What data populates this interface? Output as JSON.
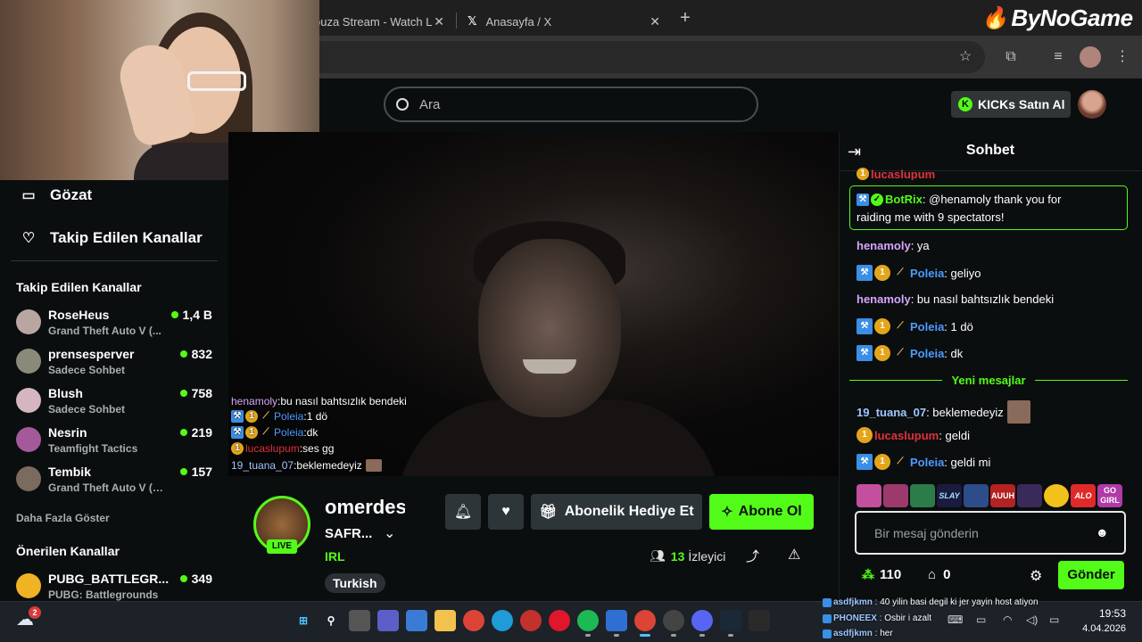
{
  "browser": {
    "tabs": [
      {
        "title": "ouza Stream - Watch L"
      },
      {
        "title": "Anasayfa / X"
      }
    ],
    "new_tab": "+",
    "close": "✕"
  },
  "watermark": "ByNoGame",
  "header": {
    "search_placeholder": "Ara",
    "kicks_button": "KICKs Satın Al"
  },
  "sidebar": {
    "nav": [
      {
        "label": "Gözat",
        "icon": "browse-icon"
      },
      {
        "label": "Takip Edilen Kanallar",
        "icon": "heart-icon"
      }
    ],
    "followed_title": "Takip Edilen Kanallar",
    "followed": [
      {
        "name": "RoseHeus",
        "category": "Grand Theft Auto V (...",
        "viewers": "1,4 B",
        "color": "#b9a6a1"
      },
      {
        "name": "prensesperver",
        "category": "Sadece Sohbet",
        "viewers": "832",
        "color": "#8a8a7a"
      },
      {
        "name": "Blush",
        "category": "Sadece Sohbet",
        "viewers": "758",
        "color": "#d5b5c0"
      },
      {
        "name": "Nesrin",
        "category": "Teamfight Tactics",
        "viewers": "219",
        "color": "#a45a9a"
      },
      {
        "name": "Tembik",
        "category": "Grand Theft Auto V (G...",
        "viewers": "157",
        "color": "#7a6b5e"
      }
    ],
    "show_more": "Daha Fazla Göster",
    "recommended_title": "Önerilen Kanallar",
    "recommended": [
      {
        "name": "PUBG_BATTLEGR...",
        "category": "PUBG: Battlegrounds",
        "viewers": "349",
        "color": "#f0b323"
      }
    ]
  },
  "overlay_chat": [
    {
      "user": "henamoly",
      "text": "bu nasıl bahtsızlık bendeki",
      "user_color": "#d6a6ff",
      "badges": false
    },
    {
      "user": "Poleia",
      "text": "1 dö",
      "user_color": "#4d9bff",
      "badges": true
    },
    {
      "user": "Poleia",
      "text": "dk",
      "user_color": "#4d9bff",
      "badges": true
    },
    {
      "user": "lucaslupum",
      "text": "ses gg",
      "user_color": "#e0323c",
      "badges": false
    },
    {
      "user": "19_tuana_07",
      "text": "beklemedeyiz",
      "user_color": "#9dc7ff",
      "badges": false
    }
  ],
  "channel": {
    "name": "omerdes",
    "title": "SAFR...",
    "category": "IRL",
    "tag": "Turkish",
    "live": "LIVE",
    "gift_button": "Abonelik Hediye Et",
    "subscribe_button": "Abone Ol",
    "viewer_count": "13",
    "viewer_label": "İzleyici"
  },
  "chat": {
    "title": "Sohbet",
    "partial_top": "lucaslupum",
    "messages": [
      {
        "user": "BotRix",
        "text": "@henamoly thank you for",
        "text2": "raiding me with 9 spectators!",
        "user_color": "#53fc18"
      },
      {
        "user": "henamoly",
        "text": "ya",
        "user_color": "#d6a6ff"
      },
      {
        "user": "Poleia",
        "text": "geliyo",
        "user_color": "#4d9bff"
      },
      {
        "user": "henamoly",
        "text": "bu nasıl bahtsızlık bendeki",
        "user_color": "#d6a6ff"
      },
      {
        "user": "Poleia",
        "text": "1 dö",
        "user_color": "#4d9bff"
      },
      {
        "user": "Poleia",
        "text": "dk",
        "user_color": "#4d9bff"
      },
      {
        "user": "19_tuana_07",
        "text": "beklemedeyiz",
        "user_color": "#9dc7ff"
      },
      {
        "user": "lucaslupum",
        "text": "geldi",
        "user_color": "#e0323c"
      },
      {
        "user": "Poleia",
        "text": "geldi mi",
        "user_color": "#4d9bff"
      }
    ],
    "new_messages": "Yeni mesajlar",
    "emotes": [
      "",
      "",
      "",
      "SLAY",
      "",
      "AUUH",
      "",
      "",
      "ALO",
      "GO GIRL"
    ],
    "input_placeholder": "Bir mesaj gönderin",
    "points": "110",
    "kicks": "0",
    "send_button": "Gönder"
  },
  "stream_overlay_bottom": [
    {
      "user": "asdfjkmn",
      "text": "40 yilin basi degil ki jer yayin host atiyon"
    },
    {
      "user": "PHONEEX",
      "text": "Osbir i azalt"
    },
    {
      "user": "asdfjkmn",
      "text": "her"
    }
  ],
  "taskbar": {
    "weather_badge": "2",
    "time": "19:53",
    "date": "4.04.2026"
  }
}
